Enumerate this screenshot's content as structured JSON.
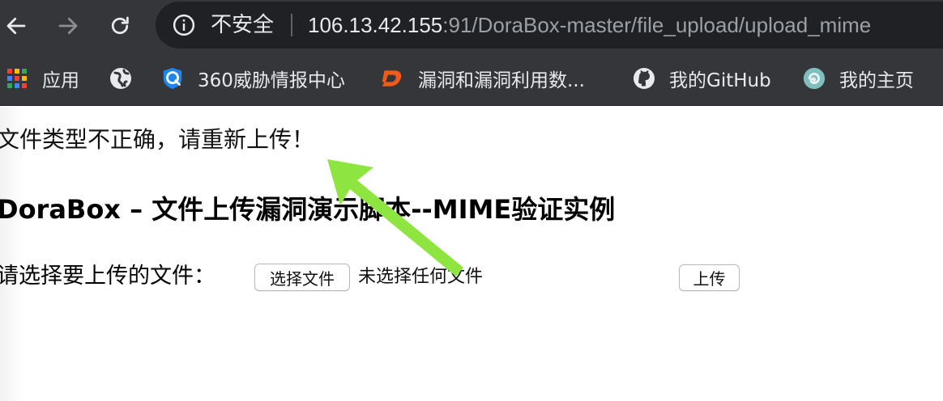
{
  "browser": {
    "security_label": "不安全",
    "url_host": "106.13.42.155",
    "url_rest": ":91/DoraBox-master/file_upload/upload_mime",
    "icons": {
      "back": "back-arrow-icon",
      "forward": "forward-arrow-icon",
      "reload": "reload-icon",
      "info": "info-icon"
    }
  },
  "bookmarks": {
    "items": [
      {
        "label": "应用",
        "icon": "apps-grid-icon"
      },
      {
        "label": "",
        "icon": "globe-icon"
      },
      {
        "label": "360威胁情报中心",
        "icon": "shield-icon"
      },
      {
        "label": "漏洞和漏洞利用数...",
        "icon": "d-logo-icon"
      },
      {
        "label": "我的GitHub",
        "icon": "github-icon"
      },
      {
        "label": "我的主页",
        "icon": "swirl-icon"
      }
    ]
  },
  "page": {
    "error_message": "文件类型不正确，请重新上传！",
    "heading": "DoraBox – 文件上传漏洞演示脚本--MIME验证实例",
    "form_label": "请选择要上传的文件：",
    "choose_file_button": "选择文件",
    "no_file_text": "未选择任何文件",
    "submit_button": "上传"
  },
  "colors": {
    "chrome_bg": "#35363a",
    "omnibox_bg": "#202124",
    "annotation_arrow": "#8ee53f"
  }
}
